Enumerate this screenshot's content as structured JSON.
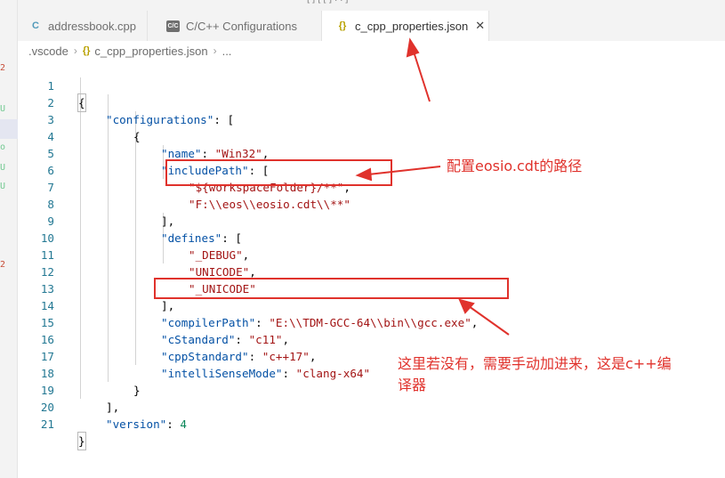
{
  "window": {
    "title_fragment": "[ ] [ [-] . . ]"
  },
  "tabs": [
    {
      "label": "addressbook.cpp",
      "icon": "C"
    },
    {
      "label": "C/C++ Configurations",
      "icon": "C/C"
    },
    {
      "label": "c_cpp_properties.json",
      "icon": "{}",
      "active": true
    }
  ],
  "breadcrumb": {
    "folder": ".vscode",
    "file": "c_cpp_properties.json",
    "more": "..."
  },
  "left_markers": [
    "2",
    "U",
    "o",
    "U",
    "U",
    "2"
  ],
  "lines": [
    {
      "n": "1",
      "text": "{"
    },
    {
      "n": "2",
      "key": "\"configurations\"",
      "rest": ": ["
    },
    {
      "n": "3",
      "text": "{"
    },
    {
      "n": "4",
      "key": "\"name\"",
      "sep": ": ",
      "str": "\"Win32\"",
      "tail": ","
    },
    {
      "n": "5",
      "key": "\"includePath\"",
      "rest": ": ["
    },
    {
      "n": "6",
      "str": "\"${workspaceFolder}/**\"",
      "tail": ","
    },
    {
      "n": "7",
      "str": "\"F:\\\\eos\\\\eosio.cdt\\\\**\""
    },
    {
      "n": "8",
      "text": "],"
    },
    {
      "n": "9",
      "key": "\"defines\"",
      "rest": ": ["
    },
    {
      "n": "10",
      "str": "\"_DEBUG\"",
      "tail": ","
    },
    {
      "n": "11",
      "str": "\"UNICODE\"",
      "tail": ","
    },
    {
      "n": "12",
      "str": "\"_UNICODE\""
    },
    {
      "n": "13",
      "text": "],"
    },
    {
      "n": "14",
      "key": "\"compilerPath\"",
      "sep": ": ",
      "str": "\"E:\\\\TDM-GCC-64\\\\bin\\\\gcc.exe\"",
      "tail": ","
    },
    {
      "n": "15",
      "key": "\"cStandard\"",
      "sep": ": ",
      "str": "\"c11\"",
      "tail": ","
    },
    {
      "n": "16",
      "key": "\"cppStandard\"",
      "sep": ": ",
      "str": "\"c++17\"",
      "tail": ","
    },
    {
      "n": "17",
      "key": "\"intelliSenseMode\"",
      "sep": ": ",
      "str": "\"clang-x64\""
    },
    {
      "n": "18",
      "text": "}"
    },
    {
      "n": "19",
      "text": "],"
    },
    {
      "n": "20",
      "key": "\"version\"",
      "sep": ": ",
      "num": "4"
    },
    {
      "n": "21",
      "text": "}"
    }
  ],
  "annotations": {
    "include_note": "配置eosio.cdt的路径",
    "compiler_note_line1": "这里若没有，需要手动加进来，这是c++编",
    "compiler_note_line2": "译器"
  },
  "colors": {
    "annotation_red": "#e0322c",
    "json_key": "#0451a5",
    "json_string": "#a31515",
    "json_number": "#098658",
    "line_number": "#237893"
  }
}
